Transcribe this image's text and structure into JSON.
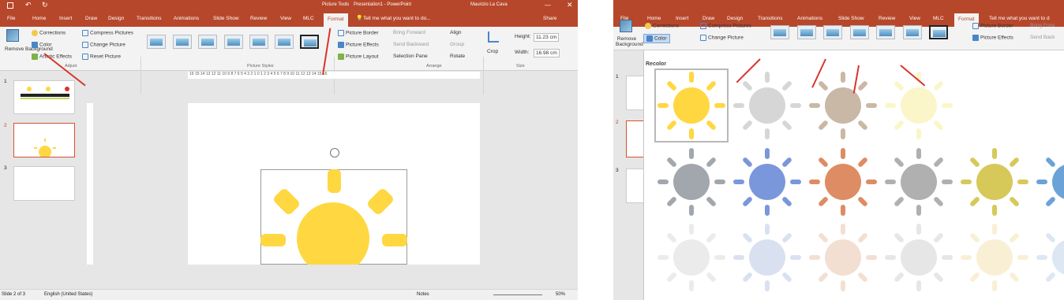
{
  "left": {
    "title": {
      "context": "Picture Tools",
      "doc": "Presentation1 - PowerPoint",
      "user": "Maurizio La Cava"
    },
    "tabs": [
      "File",
      "Home",
      "Insert",
      "Draw",
      "Design",
      "Transitions",
      "Animations",
      "Slide Show",
      "Review",
      "View",
      "MLC",
      "Format"
    ],
    "tell_me": "Tell me what you want to do...",
    "share": "Share",
    "adjust": {
      "remove_bg": "Remove Background",
      "corrections": "Corrections",
      "color": "Color",
      "artistic": "Artistic Effects",
      "compress": "Compress Pictures",
      "change": "Change Picture",
      "reset": "Reset Picture",
      "label": "Adjust"
    },
    "styles_label": "Picture Styles",
    "picture": {
      "border": "Picture Border",
      "effects": "Picture Effects",
      "layout": "Picture Layout"
    },
    "arrange": {
      "forward": "Bring Forward",
      "backward": "Send Backward",
      "pane": "Selection Pane",
      "align": "Align",
      "group": "Group",
      "rotate": "Rotate",
      "label": "Arrange"
    },
    "size": {
      "crop": "Crop",
      "height": "Height:",
      "height_val": "11.23 cm",
      "width": "Width:",
      "width_val": "16.98 cm",
      "label": "Size"
    },
    "ruler": "16 15 14 13 12 11 10 9 8 7 6 5 4 3 2 1 0 1 2 3 4 5 6 7 8 9 10 11 12 13 14 15 16",
    "slides": [
      "1",
      "2",
      "3"
    ],
    "status": {
      "slide": "Slide 2 of 3",
      "lang": "English (United States)",
      "notes": "Notes",
      "zoom": "50%"
    }
  },
  "right": {
    "tabs": [
      "File",
      "Home",
      "Insert",
      "Draw",
      "Design",
      "Transitions",
      "Animations",
      "Slide Show",
      "Review",
      "View",
      "MLC",
      "Format"
    ],
    "tell_me": "Tell me what you want to d",
    "adjust": {
      "remove_bg": "Remove Background",
      "corrections": "Corrections",
      "color": "Color",
      "compress": "Compress Pictures",
      "change": "Change Picture"
    },
    "picture": {
      "border": "Picture Border",
      "effects": "Picture Effects"
    },
    "arrange": {
      "forward": "Bring Forw",
      "backward": "Send Back"
    },
    "recolor": "Recolor",
    "colors": {
      "row1": [
        "#ffd740",
        "#d6d6d6",
        "#c9b8a6",
        "#fbf6c9"
      ],
      "row2": [
        "#a2a7ae",
        "#7a97dc",
        "#de8c63",
        "#b0b0b0",
        "#d6c95a",
        "#6ba3d8"
      ],
      "row3": [
        "#ebebeb",
        "#d9e1f1",
        "#f3dfd1",
        "#e6e6e6",
        "#f9efd5",
        "#dde7f3"
      ]
    },
    "slides": [
      "1",
      "2",
      "3"
    ]
  }
}
